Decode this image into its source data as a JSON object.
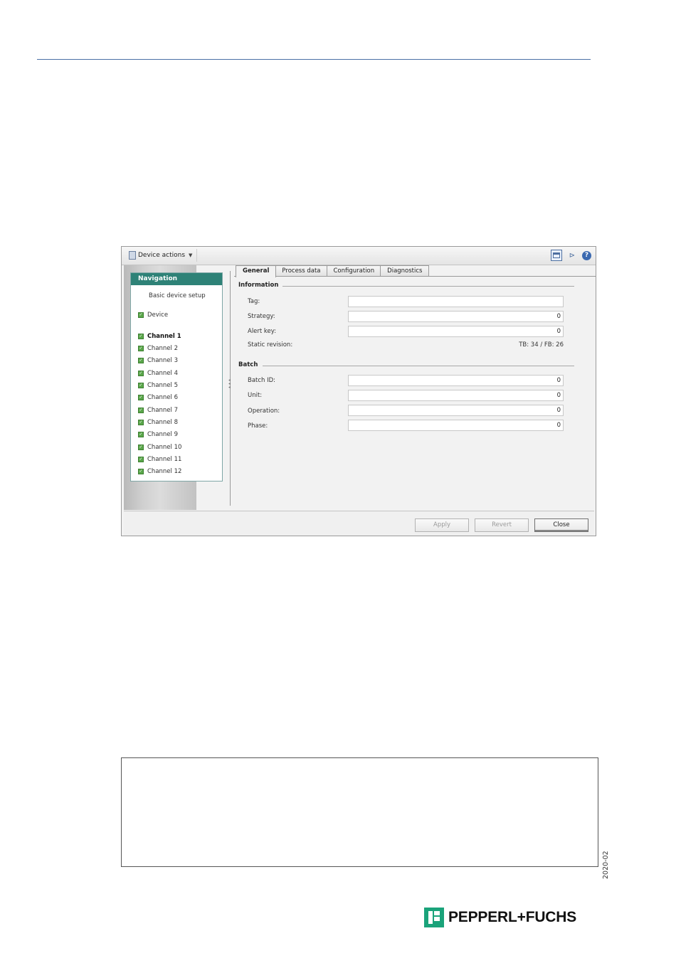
{
  "toolbar": {
    "device_actions_label": "Device actions",
    "icons": [
      "window-icon",
      "pin-icon",
      "help-icon"
    ],
    "help_glyph": "?"
  },
  "navigation": {
    "title": "Navigation",
    "basic_setup": "Basic device setup",
    "device": "Device",
    "channels": [
      "Channel 1",
      "Channel 2",
      "Channel 3",
      "Channel 4",
      "Channel 5",
      "Channel 6",
      "Channel 7",
      "Channel 8",
      "Channel 9",
      "Channel 10",
      "Channel 11",
      "Channel 12"
    ],
    "active": "Channel 1"
  },
  "tabs": [
    "General",
    "Process data",
    "Configuration",
    "Diagnostics"
  ],
  "active_tab": "General",
  "information": {
    "title": "Information",
    "tag_label": "Tag:",
    "tag_value": "",
    "strategy_label": "Strategy:",
    "strategy_value": "0",
    "alert_key_label": "Alert key:",
    "alert_key_value": "0",
    "static_revision_label": "Static revision:",
    "static_revision_value": "TB: 34 / FB: 26"
  },
  "batch": {
    "title": "Batch",
    "batch_id_label": "Batch ID:",
    "batch_id_value": "0",
    "unit_label": "Unit:",
    "unit_value": "0",
    "operation_label": "Operation:",
    "operation_value": "0",
    "phase_label": "Phase:",
    "phase_value": "0"
  },
  "buttons": {
    "apply": "Apply",
    "revert": "Revert",
    "close": "Close"
  },
  "doc_id": "2020-02",
  "brand": "PEPPERL+FUCHS",
  "colors": {
    "nav_header": "#2e8277",
    "check": "#5aa74a",
    "rule": "#4a6fa5",
    "logo": "#1aa37a"
  }
}
